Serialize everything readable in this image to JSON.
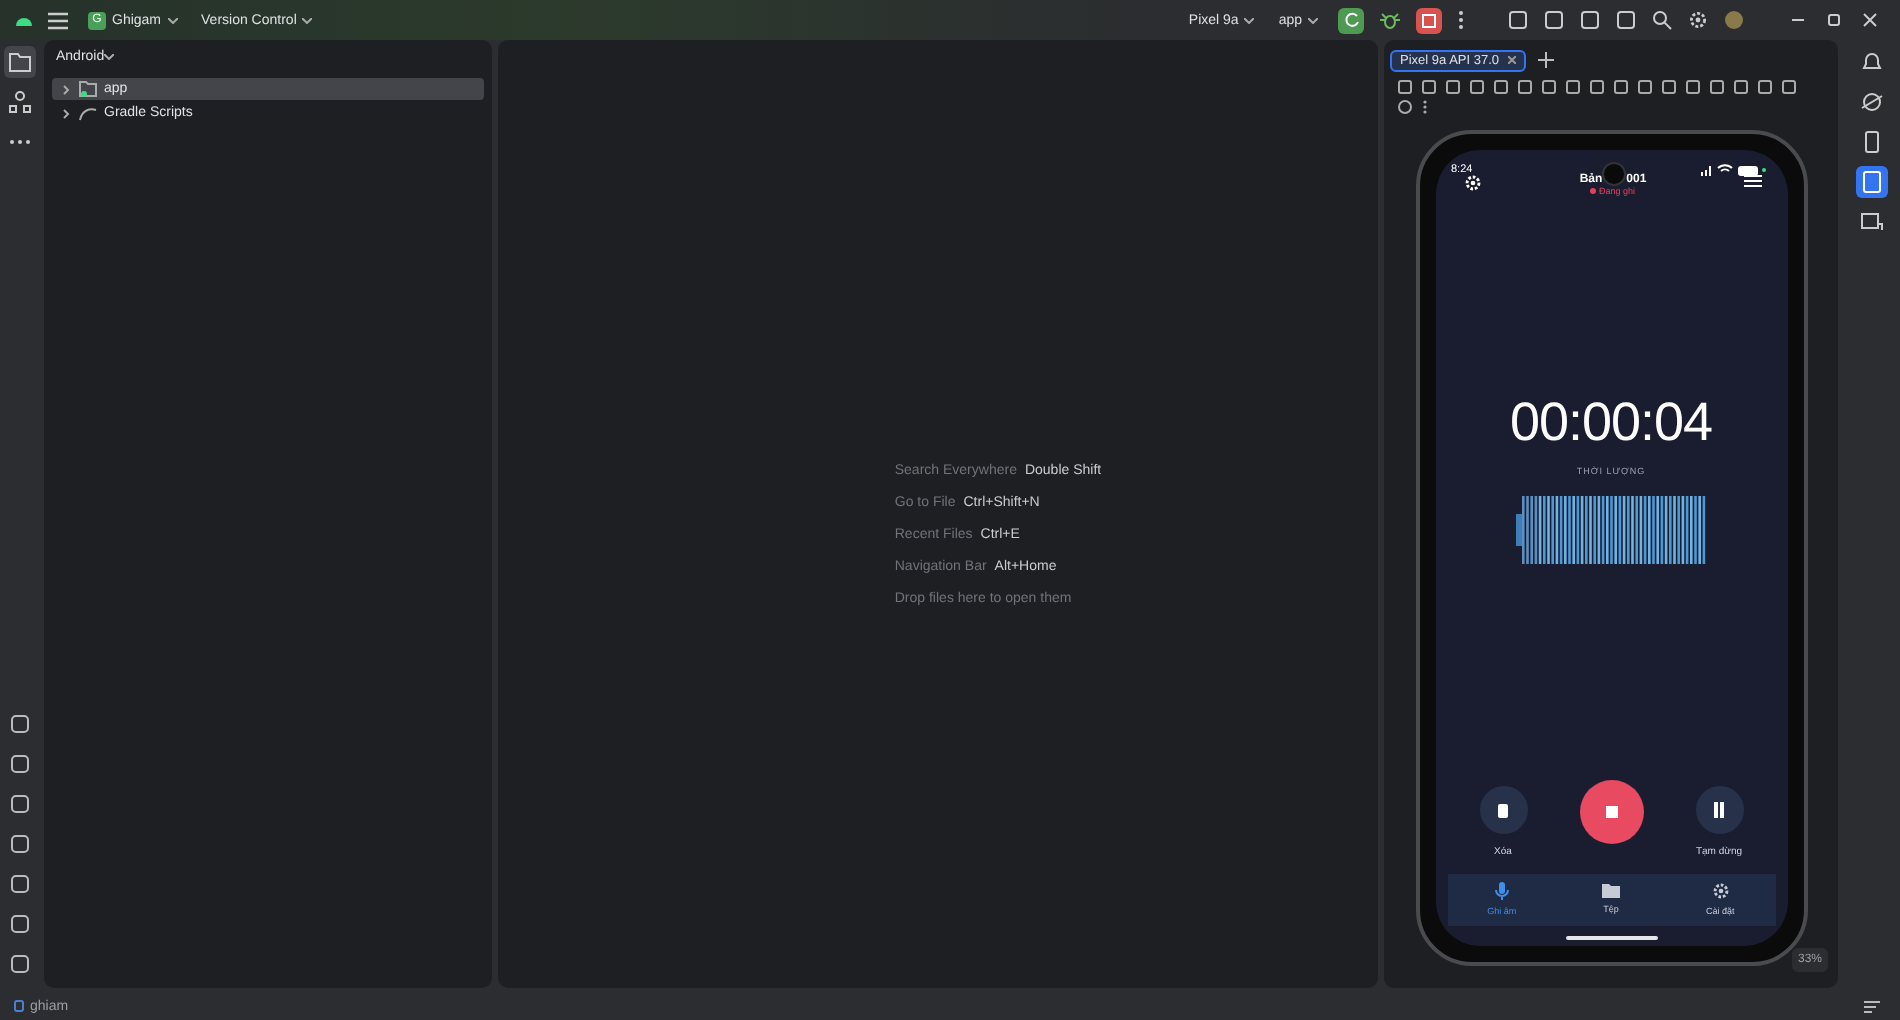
{
  "title_bar": {
    "project_badge": "G",
    "project": "Ghigam",
    "vcs": "Version Control",
    "device": "Pixel 9a",
    "run_config": "app"
  },
  "project_panel": {
    "view": "Android",
    "tree": [
      {
        "label": "app",
        "kind": "module",
        "selected": true,
        "expanded": false
      },
      {
        "label": "Gradle Scripts",
        "kind": "gradle",
        "selected": false,
        "expanded": false
      }
    ]
  },
  "editor_hints": [
    {
      "action": "Search Everywhere",
      "shortcut": "Double Shift"
    },
    {
      "action": "Go to File",
      "shortcut": "Ctrl+Shift+N"
    },
    {
      "action": "Recent Files",
      "shortcut": "Ctrl+E"
    },
    {
      "action": "Navigation Bar",
      "shortcut": "Alt+Home"
    },
    {
      "action": "Drop files here to open them"
    }
  ],
  "emulator": {
    "tabs": [
      {
        "label": "Pixel 9a API 37.0",
        "selected": true
      }
    ],
    "zoom": "33%"
  },
  "phone": {
    "clock": "8:24",
    "title_parts": [
      "Bản",
      "001"
    ],
    "status": "Đang ghi",
    "timer": "00:00:04",
    "timer_label": "THỜI LƯỢNG",
    "actions": [
      {
        "kind": "delete",
        "label": "Xóa"
      },
      {
        "kind": "stop"
      },
      {
        "kind": "pause",
        "label": "Tạm dừng"
      }
    ],
    "nav": [
      {
        "kind": "mic",
        "label": "Ghi âm",
        "selected": true
      },
      {
        "kind": "folder",
        "label": "Tệp",
        "selected": false
      },
      {
        "kind": "settings",
        "label": "Cài đặt",
        "selected": false
      }
    ]
  },
  "status_bar": {
    "path": "ghiam"
  }
}
